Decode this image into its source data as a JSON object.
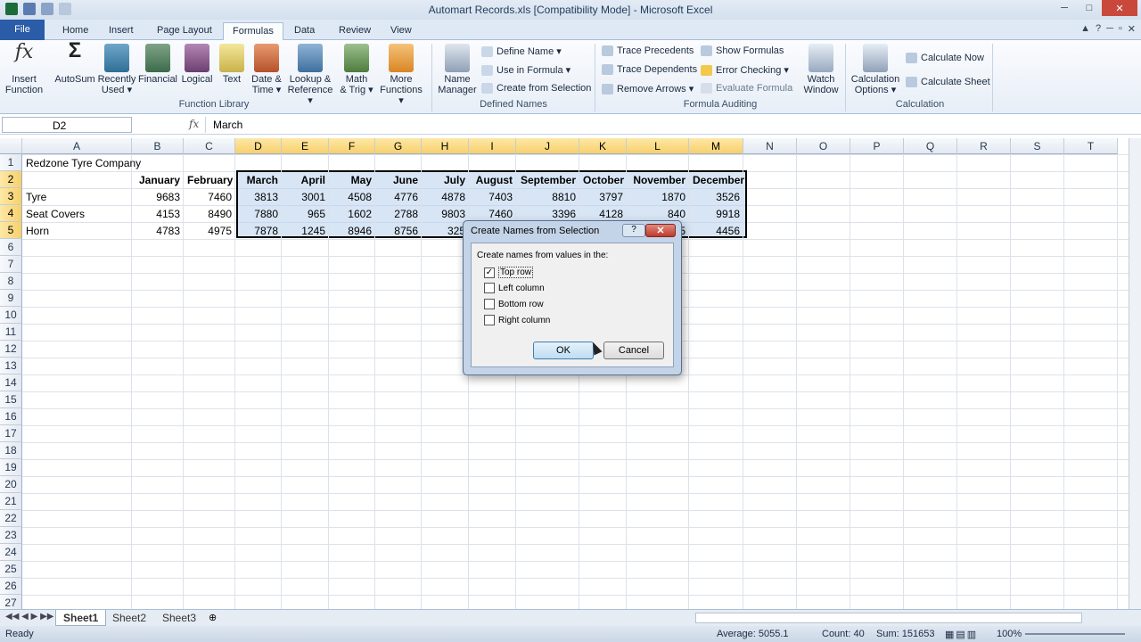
{
  "window": {
    "title": "Automart Records.xls  [Compatibility Mode]  -  Microsoft Excel"
  },
  "tabs": [
    "File",
    "Home",
    "Insert",
    "Page Layout",
    "Formulas",
    "Data",
    "Review",
    "View"
  ],
  "ribbon": {
    "function_library": {
      "label": "Function Library",
      "buttons": [
        {
          "l1": "Insert",
          "l2": "Function",
          "icon": "fx-icon"
        },
        {
          "l1": "AutoSum",
          "l2": "",
          "icon": "sigma-icon"
        },
        {
          "l1": "Recently",
          "l2": "Used ▾",
          "icon": "book-icon"
        },
        {
          "l1": "Financial",
          "l2": "",
          "icon": "book-icon"
        },
        {
          "l1": "Logical",
          "l2": "",
          "icon": "book-icon"
        },
        {
          "l1": "Text",
          "l2": "",
          "icon": "book-icon"
        },
        {
          "l1": "Date &",
          "l2": "Time ▾",
          "icon": "book-icon"
        },
        {
          "l1": "Lookup &",
          "l2": "Reference ▾",
          "icon": "book-icon"
        },
        {
          "l1": "Math",
          "l2": "& Trig ▾",
          "icon": "book-icon"
        },
        {
          "l1": "More",
          "l2": "Functions ▾",
          "icon": "book-icon"
        }
      ]
    },
    "defined_names": {
      "label": "Defined Names",
      "name_manager": {
        "l1": "Name",
        "l2": "Manager"
      },
      "items": [
        "Define Name ▾",
        "Use in Formula ▾",
        "Create from Selection"
      ]
    },
    "formula_auditing": {
      "label": "Formula Auditing",
      "items": [
        "Trace Precedents",
        "Trace Dependents",
        "Remove Arrows ▾",
        "Show Formulas",
        "Error Checking ▾",
        "Evaluate Formula"
      ],
      "watch": {
        "l1": "Watch",
        "l2": "Window"
      }
    },
    "calculation": {
      "label": "Calculation",
      "options": {
        "l1": "Calculation",
        "l2": "Options ▾"
      },
      "items": [
        "Calculate Now",
        "Calculate Sheet"
      ]
    }
  },
  "formula_bar": {
    "name_box": "D2",
    "fx": "fx",
    "content": "March"
  },
  "columns": [
    "A",
    "B",
    "C",
    "D",
    "E",
    "F",
    "G",
    "H",
    "I",
    "J",
    "K",
    "L",
    "M",
    "N",
    "O",
    "P",
    "Q",
    "R",
    "S",
    "T"
  ],
  "rows": [
    "1",
    "2",
    "3",
    "4",
    "5",
    "6",
    "7",
    "8",
    "9",
    "10",
    "11",
    "12",
    "13",
    "14",
    "15",
    "16",
    "17",
    "18",
    "19",
    "20",
    "21",
    "22",
    "23",
    "24",
    "25",
    "26",
    "27"
  ],
  "sheet": {
    "title": "Redzone Tyre Company",
    "months": [
      "January",
      "February",
      "March",
      "April",
      "May",
      "June",
      "July",
      "August",
      "September",
      "October",
      "November",
      "December"
    ],
    "items": [
      {
        "name": "Tyre",
        "values": [
          "9683",
          "7460",
          "3813",
          "3001",
          "4508",
          "4776",
          "4878",
          "7403",
          "8810",
          "3797",
          "1870",
          "3526"
        ]
      },
      {
        "name": "Seat Covers",
        "values": [
          "4153",
          "8490",
          "7880",
          "965",
          "1602",
          "2788",
          "9803",
          "7460",
          "3396",
          "4128",
          "840",
          "9918"
        ]
      },
      {
        "name": "Horn",
        "values": [
          "4783",
          "4975",
          "7878",
          "1245",
          "8946",
          "8756",
          "325",
          "",
          "",
          "",
          "25",
          "4456"
        ]
      }
    ]
  },
  "dialog": {
    "title": "Create Names from Selection",
    "prompt": "Create names from values in the:",
    "options": [
      {
        "label": "Top row",
        "checked": "✓"
      },
      {
        "label": "Left column",
        "checked": ""
      },
      {
        "label": "Bottom row",
        "checked": ""
      },
      {
        "label": "Right column",
        "checked": ""
      }
    ],
    "ok": "OK",
    "cancel": "Cancel",
    "help": "?",
    "close": "✕"
  },
  "sheet_tabs": [
    "Sheet1",
    "Sheet2",
    "Sheet3"
  ],
  "status": {
    "ready": "Ready",
    "average": "Average: 5055.1",
    "count": "Count: 40",
    "sum": "Sum: 151653",
    "zoom": "100%"
  }
}
